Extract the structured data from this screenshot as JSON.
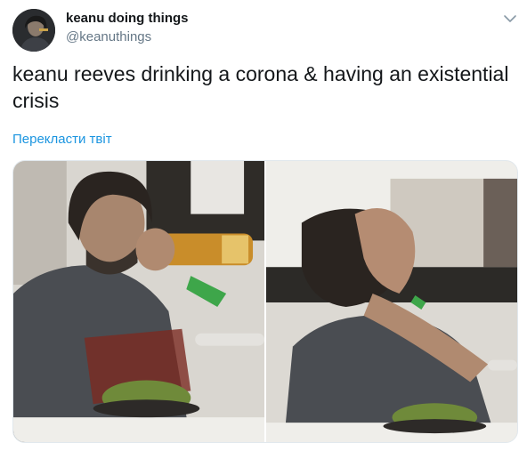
{
  "author": {
    "display_name": "keanu doing things",
    "handle": "@keanuthings",
    "avatar_icon": "avatar-keanu"
  },
  "menu_icon": "chevron-down-icon",
  "tweet": {
    "text": "keanu reeves drinking a corona & having an existential crisis",
    "translate_label": "Перекласти твіт"
  },
  "media": {
    "photos": [
      {
        "icon": "photo-drinking-bottle"
      },
      {
        "icon": "photo-face-in-hands"
      }
    ]
  },
  "colors": {
    "text": "#14171a",
    "secondary": "#657786",
    "link": "#1b95e0",
    "border": "#e1e8ed"
  }
}
